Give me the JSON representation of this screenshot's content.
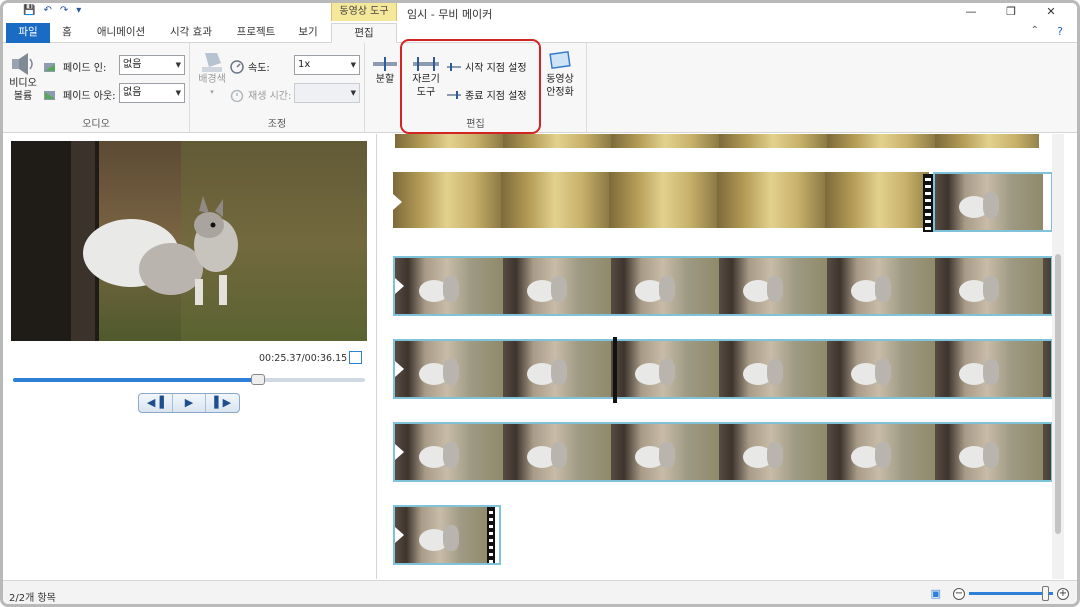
{
  "title_bar": {
    "context_tab_header": "동영상 도구",
    "window_title": "임시 - 무비 메이커",
    "quick_access": [
      "save-icon",
      "undo-icon",
      "redo-icon",
      "customize-icon"
    ]
  },
  "tabs": [
    {
      "label": "파일"
    },
    {
      "label": "홈"
    },
    {
      "label": "애니메이션"
    },
    {
      "label": "시각 효과"
    },
    {
      "label": "프로젝트"
    },
    {
      "label": "보기"
    },
    {
      "label": "편집"
    }
  ],
  "ribbon": {
    "audio": {
      "video_volume": "비디오\n볼륨",
      "fade_in_label": "페이드 인:",
      "fade_in_value": "없음",
      "fade_out_label": "페이드 아웃:",
      "fade_out_value": "없음",
      "group_label": "오디오"
    },
    "adjust": {
      "background_color": "배경색",
      "speed_label": "속도:",
      "speed_value": "1x",
      "duration_label": "재생 시간:",
      "duration_value": "",
      "group_label": "조정"
    },
    "edit": {
      "split": "분할",
      "trim_tool": "자르기\n도구",
      "set_start": "시작 지점 설정",
      "set_end": "종료 지점 설정",
      "stabilization": "동영상\n안정화",
      "group_label": "편집"
    }
  },
  "preview": {
    "timecode": "00:25.37/00:36.15",
    "seek_position": 0.695
  },
  "status": {
    "items": "2/2개 항목",
    "zoom_level": 0.95
  },
  "colors": {
    "accent": "#1a6bc4",
    "highlight": "#d32424",
    "selection_border": "#7fc2d9",
    "context_tab": "#f6e89a"
  }
}
